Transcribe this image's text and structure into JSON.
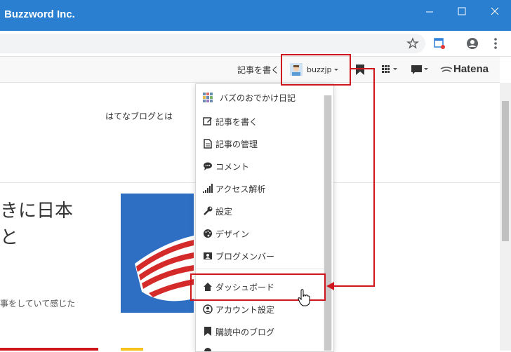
{
  "window": {
    "title": "Buzzword Inc."
  },
  "hatena_bar": {
    "write_label": "記事を書く",
    "user_name": "buzzjp",
    "brand": "Hatena"
  },
  "page": {
    "link_about": "はてなブログとは",
    "headline_line1": "きに日本",
    "headline_line2": "と",
    "snippet": "事をしていて感じた"
  },
  "menu": {
    "items": [
      {
        "label": "バズのおでかけ日記",
        "icon": "blog-icon"
      },
      {
        "label": "記事を書く",
        "icon": "edit-icon"
      },
      {
        "label": "記事の管理",
        "icon": "document-icon"
      },
      {
        "label": "コメント",
        "icon": "comment-icon"
      },
      {
        "label": "アクセス解析",
        "icon": "signal-icon"
      },
      {
        "label": "設定",
        "icon": "wrench-icon"
      },
      {
        "label": "デザイン",
        "icon": "palette-icon"
      },
      {
        "label": "ブログメンバー",
        "icon": "members-icon"
      },
      {
        "label": "ダッシュボード",
        "icon": "home-icon"
      },
      {
        "label": "アカウント設定",
        "icon": "account-icon"
      },
      {
        "label": "購読中のブログ",
        "icon": "bookmark-icon"
      }
    ]
  },
  "colors": {
    "titlebar": "#2a7fd0",
    "highlight": "#d0161d"
  }
}
